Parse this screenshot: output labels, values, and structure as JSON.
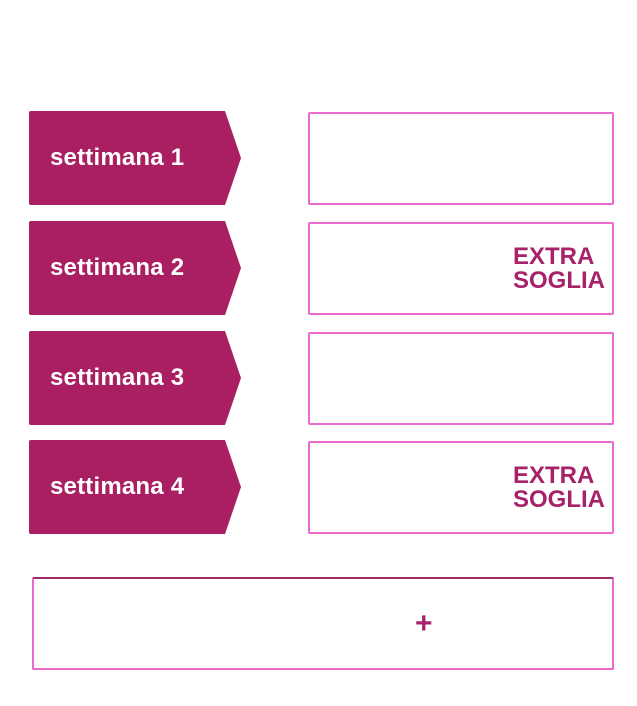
{
  "colors": {
    "tag_background": "#AA1E62",
    "box_border": "#EC6ACD",
    "extra_text": "#A8226A",
    "add_border_top": "#9E2D6B"
  },
  "weeks": [
    {
      "label": "settimana 1",
      "extra": false,
      "extra_lines": []
    },
    {
      "label": "settimana 2",
      "extra": true,
      "extra_lines": [
        "EXTRA",
        "SOGLIA"
      ]
    },
    {
      "label": "settimana 3",
      "extra": false,
      "extra_lines": []
    },
    {
      "label": "settimana 4",
      "extra": true,
      "extra_lines": [
        "EXTRA",
        "SOGLIA"
      ]
    }
  ],
  "add_button": {
    "label": "+",
    "icon": "plus-icon"
  }
}
